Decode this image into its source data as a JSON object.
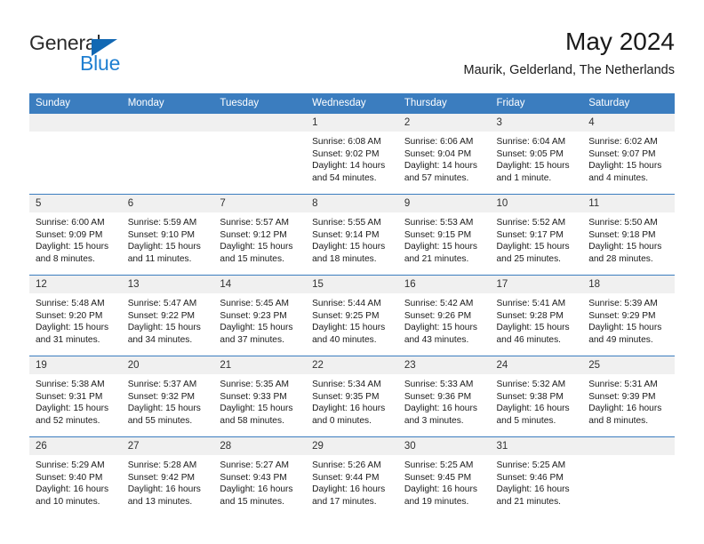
{
  "logo": {
    "word_top": "General",
    "word_bottom": "Blue",
    "triangle_icon": "triangle-icon",
    "color_dark": "#2b2b2b",
    "color_blue": "#1f7fd1"
  },
  "header": {
    "title": "May 2024",
    "subtitle": "Maurik, Gelderland, The Netherlands"
  },
  "theme": {
    "header_bg": "#3b7dbf",
    "daynum_bg": "#f0f0f0",
    "row_rule": "#3b7dbf"
  },
  "calendar": {
    "weekday_headers": [
      "Sunday",
      "Monday",
      "Tuesday",
      "Wednesday",
      "Thursday",
      "Friday",
      "Saturday"
    ],
    "weeks": [
      [
        {
          "day": "",
          "lines": [
            "",
            "",
            "",
            ""
          ]
        },
        {
          "day": "",
          "lines": [
            "",
            "",
            "",
            ""
          ]
        },
        {
          "day": "",
          "lines": [
            "",
            "",
            "",
            ""
          ]
        },
        {
          "day": "1",
          "lines": [
            "Sunrise: 6:08 AM",
            "Sunset: 9:02 PM",
            "Daylight: 14 hours",
            "and 54 minutes."
          ]
        },
        {
          "day": "2",
          "lines": [
            "Sunrise: 6:06 AM",
            "Sunset: 9:04 PM",
            "Daylight: 14 hours",
            "and 57 minutes."
          ]
        },
        {
          "day": "3",
          "lines": [
            "Sunrise: 6:04 AM",
            "Sunset: 9:05 PM",
            "Daylight: 15 hours",
            "and 1 minute."
          ]
        },
        {
          "day": "4",
          "lines": [
            "Sunrise: 6:02 AM",
            "Sunset: 9:07 PM",
            "Daylight: 15 hours",
            "and 4 minutes."
          ]
        }
      ],
      [
        {
          "day": "5",
          "lines": [
            "Sunrise: 6:00 AM",
            "Sunset: 9:09 PM",
            "Daylight: 15 hours",
            "and 8 minutes."
          ]
        },
        {
          "day": "6",
          "lines": [
            "Sunrise: 5:59 AM",
            "Sunset: 9:10 PM",
            "Daylight: 15 hours",
            "and 11 minutes."
          ]
        },
        {
          "day": "7",
          "lines": [
            "Sunrise: 5:57 AM",
            "Sunset: 9:12 PM",
            "Daylight: 15 hours",
            "and 15 minutes."
          ]
        },
        {
          "day": "8",
          "lines": [
            "Sunrise: 5:55 AM",
            "Sunset: 9:14 PM",
            "Daylight: 15 hours",
            "and 18 minutes."
          ]
        },
        {
          "day": "9",
          "lines": [
            "Sunrise: 5:53 AM",
            "Sunset: 9:15 PM",
            "Daylight: 15 hours",
            "and 21 minutes."
          ]
        },
        {
          "day": "10",
          "lines": [
            "Sunrise: 5:52 AM",
            "Sunset: 9:17 PM",
            "Daylight: 15 hours",
            "and 25 minutes."
          ]
        },
        {
          "day": "11",
          "lines": [
            "Sunrise: 5:50 AM",
            "Sunset: 9:18 PM",
            "Daylight: 15 hours",
            "and 28 minutes."
          ]
        }
      ],
      [
        {
          "day": "12",
          "lines": [
            "Sunrise: 5:48 AM",
            "Sunset: 9:20 PM",
            "Daylight: 15 hours",
            "and 31 minutes."
          ]
        },
        {
          "day": "13",
          "lines": [
            "Sunrise: 5:47 AM",
            "Sunset: 9:22 PM",
            "Daylight: 15 hours",
            "and 34 minutes."
          ]
        },
        {
          "day": "14",
          "lines": [
            "Sunrise: 5:45 AM",
            "Sunset: 9:23 PM",
            "Daylight: 15 hours",
            "and 37 minutes."
          ]
        },
        {
          "day": "15",
          "lines": [
            "Sunrise: 5:44 AM",
            "Sunset: 9:25 PM",
            "Daylight: 15 hours",
            "and 40 minutes."
          ]
        },
        {
          "day": "16",
          "lines": [
            "Sunrise: 5:42 AM",
            "Sunset: 9:26 PM",
            "Daylight: 15 hours",
            "and 43 minutes."
          ]
        },
        {
          "day": "17",
          "lines": [
            "Sunrise: 5:41 AM",
            "Sunset: 9:28 PM",
            "Daylight: 15 hours",
            "and 46 minutes."
          ]
        },
        {
          "day": "18",
          "lines": [
            "Sunrise: 5:39 AM",
            "Sunset: 9:29 PM",
            "Daylight: 15 hours",
            "and 49 minutes."
          ]
        }
      ],
      [
        {
          "day": "19",
          "lines": [
            "Sunrise: 5:38 AM",
            "Sunset: 9:31 PM",
            "Daylight: 15 hours",
            "and 52 minutes."
          ]
        },
        {
          "day": "20",
          "lines": [
            "Sunrise: 5:37 AM",
            "Sunset: 9:32 PM",
            "Daylight: 15 hours",
            "and 55 minutes."
          ]
        },
        {
          "day": "21",
          "lines": [
            "Sunrise: 5:35 AM",
            "Sunset: 9:33 PM",
            "Daylight: 15 hours",
            "and 58 minutes."
          ]
        },
        {
          "day": "22",
          "lines": [
            "Sunrise: 5:34 AM",
            "Sunset: 9:35 PM",
            "Daylight: 16 hours",
            "and 0 minutes."
          ]
        },
        {
          "day": "23",
          "lines": [
            "Sunrise: 5:33 AM",
            "Sunset: 9:36 PM",
            "Daylight: 16 hours",
            "and 3 minutes."
          ]
        },
        {
          "day": "24",
          "lines": [
            "Sunrise: 5:32 AM",
            "Sunset: 9:38 PM",
            "Daylight: 16 hours",
            "and 5 minutes."
          ]
        },
        {
          "day": "25",
          "lines": [
            "Sunrise: 5:31 AM",
            "Sunset: 9:39 PM",
            "Daylight: 16 hours",
            "and 8 minutes."
          ]
        }
      ],
      [
        {
          "day": "26",
          "lines": [
            "Sunrise: 5:29 AM",
            "Sunset: 9:40 PM",
            "Daylight: 16 hours",
            "and 10 minutes."
          ]
        },
        {
          "day": "27",
          "lines": [
            "Sunrise: 5:28 AM",
            "Sunset: 9:42 PM",
            "Daylight: 16 hours",
            "and 13 minutes."
          ]
        },
        {
          "day": "28",
          "lines": [
            "Sunrise: 5:27 AM",
            "Sunset: 9:43 PM",
            "Daylight: 16 hours",
            "and 15 minutes."
          ]
        },
        {
          "day": "29",
          "lines": [
            "Sunrise: 5:26 AM",
            "Sunset: 9:44 PM",
            "Daylight: 16 hours",
            "and 17 minutes."
          ]
        },
        {
          "day": "30",
          "lines": [
            "Sunrise: 5:25 AM",
            "Sunset: 9:45 PM",
            "Daylight: 16 hours",
            "and 19 minutes."
          ]
        },
        {
          "day": "31",
          "lines": [
            "Sunrise: 5:25 AM",
            "Sunset: 9:46 PM",
            "Daylight: 16 hours",
            "and 21 minutes."
          ]
        },
        {
          "day": "",
          "lines": [
            "",
            "",
            "",
            ""
          ]
        }
      ]
    ]
  }
}
